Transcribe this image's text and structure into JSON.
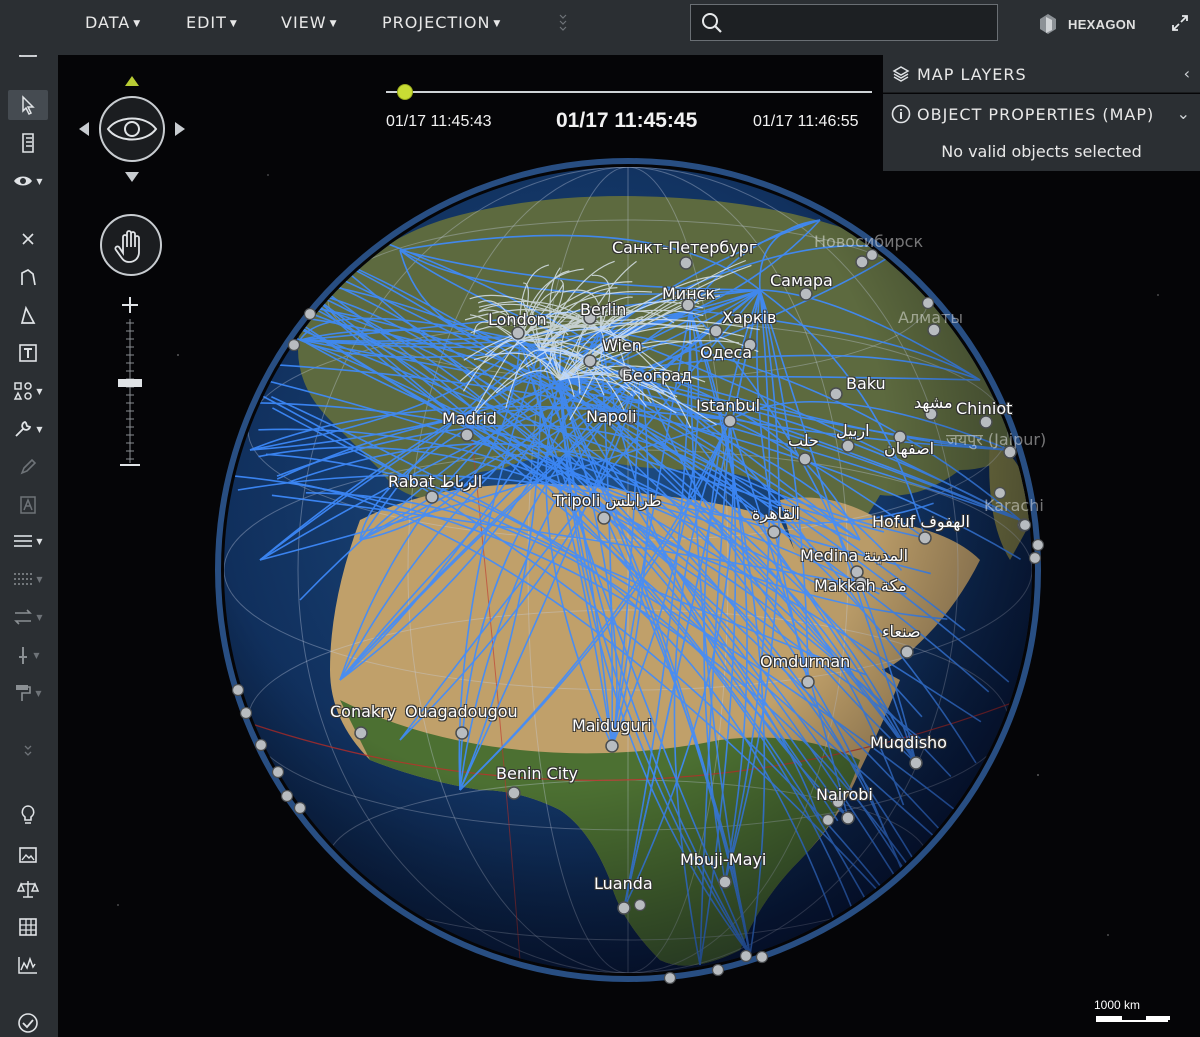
{
  "menu": {
    "items": [
      {
        "label": "DATA"
      },
      {
        "label": "EDIT"
      },
      {
        "label": "VIEW"
      },
      {
        "label": "PROJECTION"
      }
    ],
    "search_placeholder": ""
  },
  "brand": {
    "name": "HEXAGON"
  },
  "timeline": {
    "start": "01/17 11:45:43",
    "current": "01/17 11:45:45",
    "end": "01/17 11:46:55",
    "progress": 0.04,
    "knob_color": "#c8dc34"
  },
  "panels": {
    "layers": {
      "title": "MAP LAYERS"
    },
    "properties": {
      "title": "OBJECT PROPERTIES (MAP)",
      "message": "No valid objects selected"
    }
  },
  "toolbar": {
    "icons": [
      "open-folder-icon",
      "download-icon",
      "select-arrow-icon",
      "document-icon",
      "eye-icon",
      "close-x-icon",
      "polyline-icon",
      "polygon-icon",
      "text-tool-icon",
      "shapes-icon",
      "wrench-icon",
      "pen-icon",
      "font-icon",
      "line-style-icon",
      "dotted-line-icon",
      "swap-icon",
      "pin-icon",
      "paint-roller-icon",
      "expand-icon",
      "lightbulb-icon",
      "picture-icon",
      "scales-icon",
      "table-icon",
      "chart-icon",
      "check-circle-icon"
    ]
  },
  "cities": [
    {
      "name": "Санкт-Петербург",
      "faint": false
    },
    {
      "name": "Новосибирск",
      "faint": true
    },
    {
      "name": "Минск",
      "faint": false
    },
    {
      "name": "Самара",
      "faint": false
    },
    {
      "name": "London",
      "faint": false
    },
    {
      "name": "Berlin",
      "faint": false
    },
    {
      "name": "Харків",
      "faint": false
    },
    {
      "name": "Алматы",
      "faint": true
    },
    {
      "name": "Wien",
      "faint": false
    },
    {
      "name": "Одеса",
      "faint": false
    },
    {
      "name": "Београд",
      "faint": false
    },
    {
      "name": "Baku",
      "faint": false
    },
    {
      "name": "Istanbul",
      "faint": false
    },
    {
      "name": "مشهد",
      "faint": false
    },
    {
      "name": "Chiniot",
      "faint": false
    },
    {
      "name": "Madrid",
      "faint": false
    },
    {
      "name": "Napoli",
      "faint": false
    },
    {
      "name": "اربيل",
      "faint": false
    },
    {
      "name": "حلب",
      "faint": false
    },
    {
      "name": "जयपुर (Jaipur)",
      "faint": true
    },
    {
      "name": "اصفهان",
      "faint": false
    },
    {
      "name": "Rabat الرباط",
      "faint": false
    },
    {
      "name": "Tripoli طرابلس",
      "faint": false
    },
    {
      "name": "Karachi",
      "faint": true
    },
    {
      "name": "القاهرة",
      "faint": false
    },
    {
      "name": "Hofuf الهفوف",
      "faint": false
    },
    {
      "name": "Medina المدينة",
      "faint": false
    },
    {
      "name": "Makkah مكة",
      "faint": false
    },
    {
      "name": "صنعاء",
      "faint": false
    },
    {
      "name": "Omdurman",
      "faint": false
    },
    {
      "name": "Conakry",
      "faint": false
    },
    {
      "name": "Ouagadougou",
      "faint": false
    },
    {
      "name": "Maiduguri",
      "faint": false
    },
    {
      "name": "Muqdisho",
      "faint": false
    },
    {
      "name": "Benin City",
      "faint": false
    },
    {
      "name": "Nairobi",
      "faint": false
    },
    {
      "name": "Mbuji-Mayi",
      "faint": false
    },
    {
      "name": "Luanda",
      "faint": false
    }
  ],
  "scale": {
    "label": "1000 km"
  }
}
